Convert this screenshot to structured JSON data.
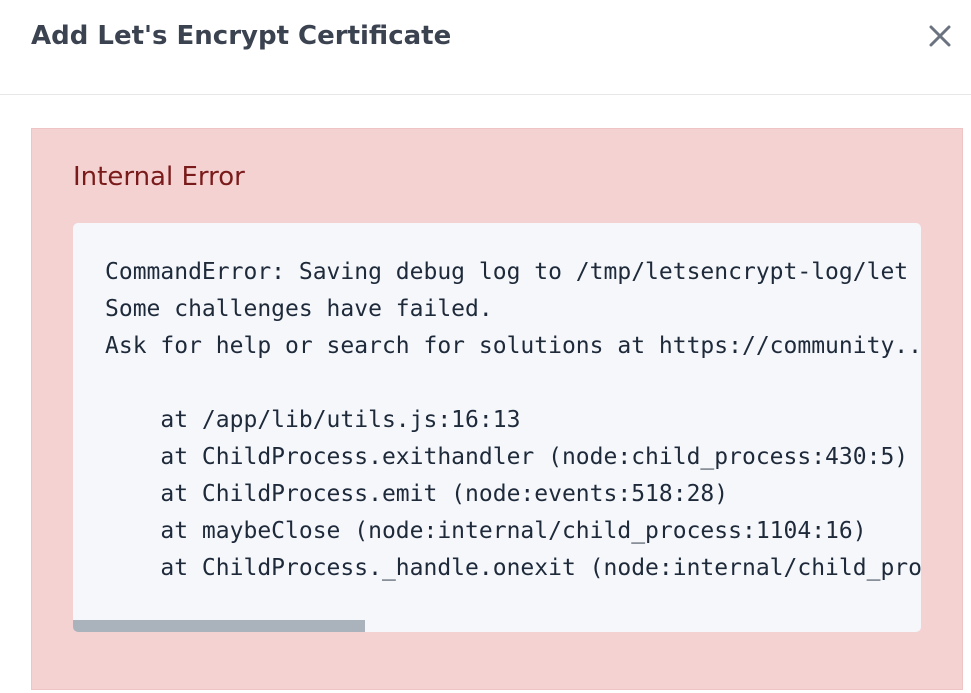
{
  "modal": {
    "title": "Add Let's Encrypt Certificate",
    "close_icon": "close-icon"
  },
  "alert": {
    "title": "Internal Error",
    "lines": [
      "CommandError: Saving debug log to /tmp/letsencrypt-log/let",
      "Some challenges have failed.",
      "Ask for help or search for solutions at https://community..",
      "",
      "    at /app/lib/utils.js:16:13",
      "    at ChildProcess.exithandler (node:child_process:430:5)",
      "    at ChildProcess.emit (node:events:518:28)",
      "    at maybeClose (node:internal/child_process:1104:16)",
      "    at ChildProcess._handle.onexit (node:internal/child_pro"
    ]
  },
  "colors": {
    "alert_background": "#f4d2d2",
    "alert_text": "#7a1b1b",
    "code_background": "#f5f7fb",
    "title_text": "#3b4250"
  }
}
